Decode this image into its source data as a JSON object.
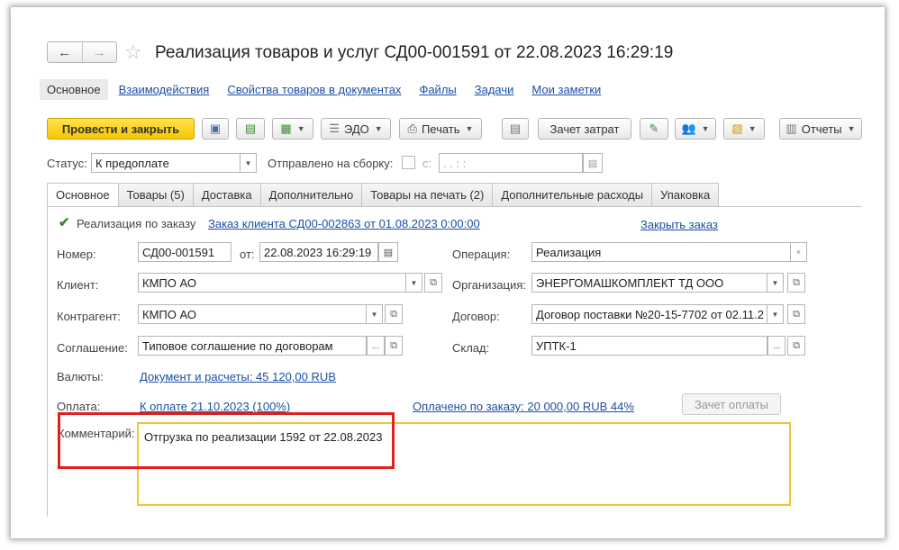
{
  "window": {
    "title": "Реализация товаров и услуг СД00-001591 от 22.08.2023 16:29:19",
    "nav_back": "←",
    "nav_forward": "→",
    "star": "☆"
  },
  "sections": [
    "Основное",
    "Взаимодействия",
    "Свойства товаров в документах",
    "Файлы",
    "Задачи",
    "Мои заметки"
  ],
  "toolbar": {
    "post_close": "Провести и закрыть",
    "edo": "ЭДО",
    "print": "Печать",
    "cost_offset": "Зачет затрат",
    "reports": "Отчеты"
  },
  "status": {
    "label": "Статус:",
    "value": "К предоплате",
    "sent_label": "Отправлено на сборку:",
    "from_label": "с:",
    "date_placeholder": ". .   : :"
  },
  "tabs": [
    "Основное",
    "Товары (5)",
    "Доставка",
    "Дополнительно",
    "Товары на печать (2)",
    "Дополнительные расходы",
    "Упаковка"
  ],
  "form": {
    "by_order_label": "Реализация по заказу",
    "order_link": "Заказ клиента СД00-002863 от 01.08.2023 0:00:00",
    "close_order": "Закрыть заказ",
    "number_label": "Номер:",
    "number_value": "СД00-001591",
    "from_label": "от:",
    "date_value": "22.08.2023 16:29:19",
    "operation_label": "Операция:",
    "operation_value": "Реализация",
    "client_label": "Клиент:",
    "client_value": "КМПО АО",
    "organization_label": "Организация:",
    "organization_value": "ЭНЕРГОМАШКОМПЛЕКТ ТД ООО",
    "counterparty_label": "Контрагент:",
    "counterparty_value": "КМПО АО",
    "contract_label": "Договор:",
    "contract_value": "Договор поставки №20-15-7702 от 02.11.2",
    "agreement_label": "Соглашение:",
    "agreement_value": "Типовое соглашение по договорам",
    "warehouse_label": "Склад:",
    "warehouse_value": "УПТК-1",
    "currency_label": "Валюты:",
    "currency_link": "Документ и расчеты: 45 120,00 RUB",
    "payment_label": "Оплата:",
    "payment_link_prefix": "К оплате ",
    "payment_link_date": "21.10.2023",
    "payment_link_suffix": " (100%)",
    "paid_link": "Оплачено по заказу: 20 000,00 RUB  44%",
    "payment_offset_btn": "Зачет оплаты",
    "comment_label": "Комментарий:",
    "comment_value": "Отгрузка по реализации 1592 от 22.08.2023"
  },
  "colors": {
    "primary_button": "#f7c600",
    "link": "#1a4fa6",
    "highlight_box": "#e0201e",
    "comment_border": "#f2c530"
  }
}
